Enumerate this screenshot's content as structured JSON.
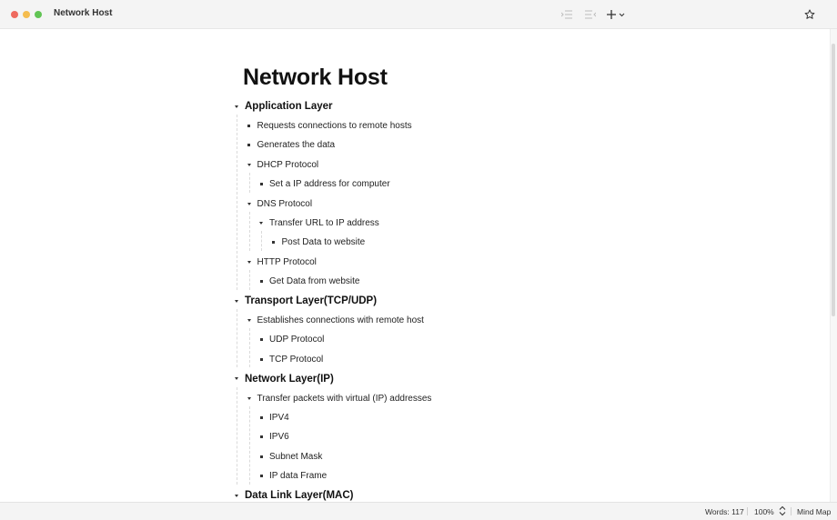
{
  "window": {
    "title": "Network Host",
    "traffic_lights": {
      "close": "#ee6a5f",
      "minimize": "#f5bd4f",
      "maximize": "#61c454"
    }
  },
  "toolbar": {
    "icons": [
      "indent-icon",
      "outdent-icon",
      "add-icon",
      "chevron-down-icon",
      "star-icon"
    ]
  },
  "document": {
    "title": "Network Host",
    "outline": [
      {
        "text": "Application Layer",
        "level": 0,
        "type": "toggle"
      },
      {
        "text": "Requests connections to remote hosts",
        "level": 1,
        "type": "bullet"
      },
      {
        "text": "Generates the data",
        "level": 1,
        "type": "bullet"
      },
      {
        "text": "DHCP Protocol",
        "level": 1,
        "type": "toggle"
      },
      {
        "text": "Set a IP address for computer",
        "level": 2,
        "type": "bullet"
      },
      {
        "text": "DNS Protocol",
        "level": 1,
        "type": "toggle"
      },
      {
        "text": "Transfer URL to IP address",
        "level": 2,
        "type": "toggle"
      },
      {
        "text": "Post Data to website",
        "level": 3,
        "type": "bullet"
      },
      {
        "text": "HTTP Protocol",
        "level": 1,
        "type": "toggle"
      },
      {
        "text": "Get Data from website",
        "level": 2,
        "type": "bullet"
      },
      {
        "text": "Transport Layer(TCP/UDP)",
        "level": 0,
        "type": "toggle"
      },
      {
        "text": "Establishes connections with remote host",
        "level": 1,
        "type": "toggle"
      },
      {
        "text": "UDP Protocol",
        "level": 2,
        "type": "bullet"
      },
      {
        "text": "TCP Protocol",
        "level": 2,
        "type": "bullet"
      },
      {
        "text": "Network Layer(IP)",
        "level": 0,
        "type": "toggle"
      },
      {
        "text": "Transfer packets with virtual (IP) addresses",
        "level": 1,
        "type": "toggle"
      },
      {
        "text": "IPV4",
        "level": 2,
        "type": "bullet"
      },
      {
        "text": "IPV6",
        "level": 2,
        "type": "bullet"
      },
      {
        "text": "Subnet  Mask",
        "level": 2,
        "type": "bullet"
      },
      {
        "text": "IP data Frame",
        "level": 2,
        "type": "bullet"
      },
      {
        "text": "Data Link Layer(MAC)",
        "level": 0,
        "type": "toggle"
      }
    ]
  },
  "statusbar": {
    "words": "Words: 117",
    "zoom": "100%",
    "zoom_stepper": "⌃⌄",
    "mode": "Mind Map"
  }
}
